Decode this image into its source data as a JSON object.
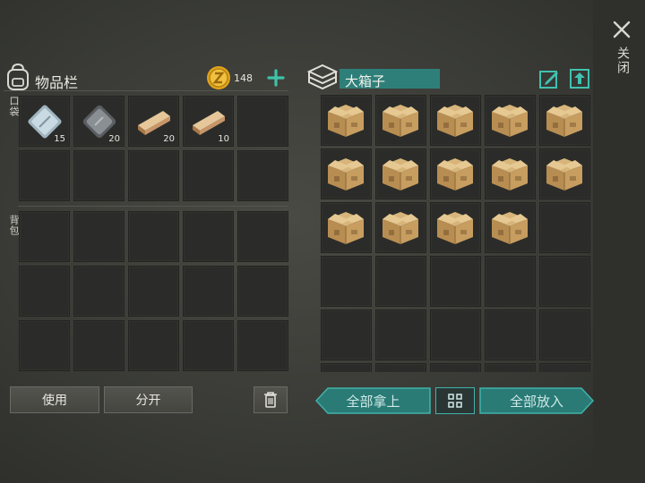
{
  "close": {
    "label": "关闭"
  },
  "inventory": {
    "title": "物品栏",
    "coins": "148",
    "pocket_label": "口袋",
    "backpack_label": "背包",
    "pocket_items": [
      {
        "name": "metal-plate",
        "count": "15"
      },
      {
        "name": "iron-plate",
        "count": "20"
      },
      {
        "name": "wood-plank",
        "count": "20"
      },
      {
        "name": "wood-plank",
        "count": "10"
      }
    ],
    "use_label": "使用",
    "split_label": "分开"
  },
  "container": {
    "name": "大箱子",
    "box_count": 14,
    "take_all_label": "全部拿上",
    "put_all_label": "全部放入"
  },
  "icons": {
    "close": "close-icon",
    "backpack": "backpack-icon",
    "coin": "coin-icon",
    "add": "plus-icon",
    "chest": "chest-icon",
    "rename": "edit-icon",
    "upgrade": "upgrade-icon",
    "trash": "trash-icon",
    "sort": "grid-icon",
    "box": "cardboard-box-icon"
  },
  "colors": {
    "accent": "#2a8c86",
    "coin": "#e0a51c",
    "plus": "#3fc2a9"
  }
}
